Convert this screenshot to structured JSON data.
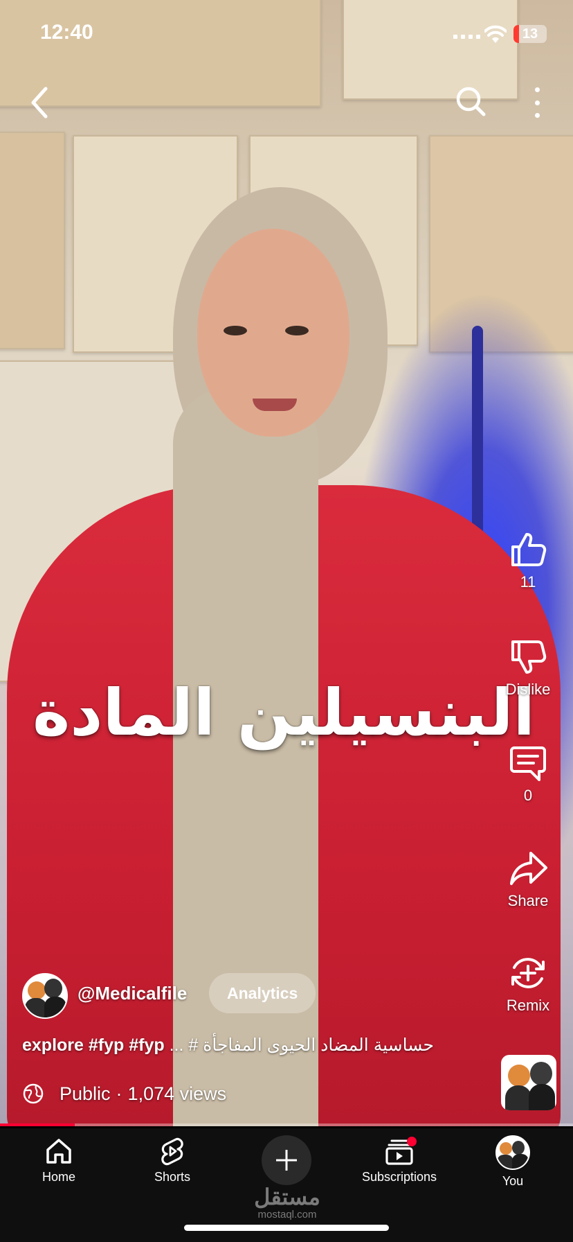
{
  "status_bar": {
    "time": "12:40",
    "battery": "13"
  },
  "video": {
    "overlay_title": "البنسيلين المادة"
  },
  "actions": {
    "like_count": "11",
    "dislike_label": "Dislike",
    "comment_count": "0",
    "share_label": "Share",
    "remix_label": "Remix"
  },
  "channel": {
    "handle": "@Medicalfile",
    "analytics_label": "Analytics"
  },
  "caption": {
    "tags": "explore #fyp #fyp",
    "text": "... # حساسية المضاد الحيوى المفاجأة"
  },
  "meta": {
    "visibility": "Public",
    "separator": "·",
    "views": "1,074 views"
  },
  "progress": {
    "fraction": 0.13
  },
  "bottom_nav": {
    "home": "Home",
    "shorts": "Shorts",
    "subscriptions": "Subscriptions",
    "you": "You"
  },
  "watermark": {
    "arabic": "مستقل",
    "latin": "mostaql.com"
  },
  "colors": {
    "accent": "#ff0033",
    "shirt": "#d92b3c",
    "glow": "#2838ff"
  }
}
